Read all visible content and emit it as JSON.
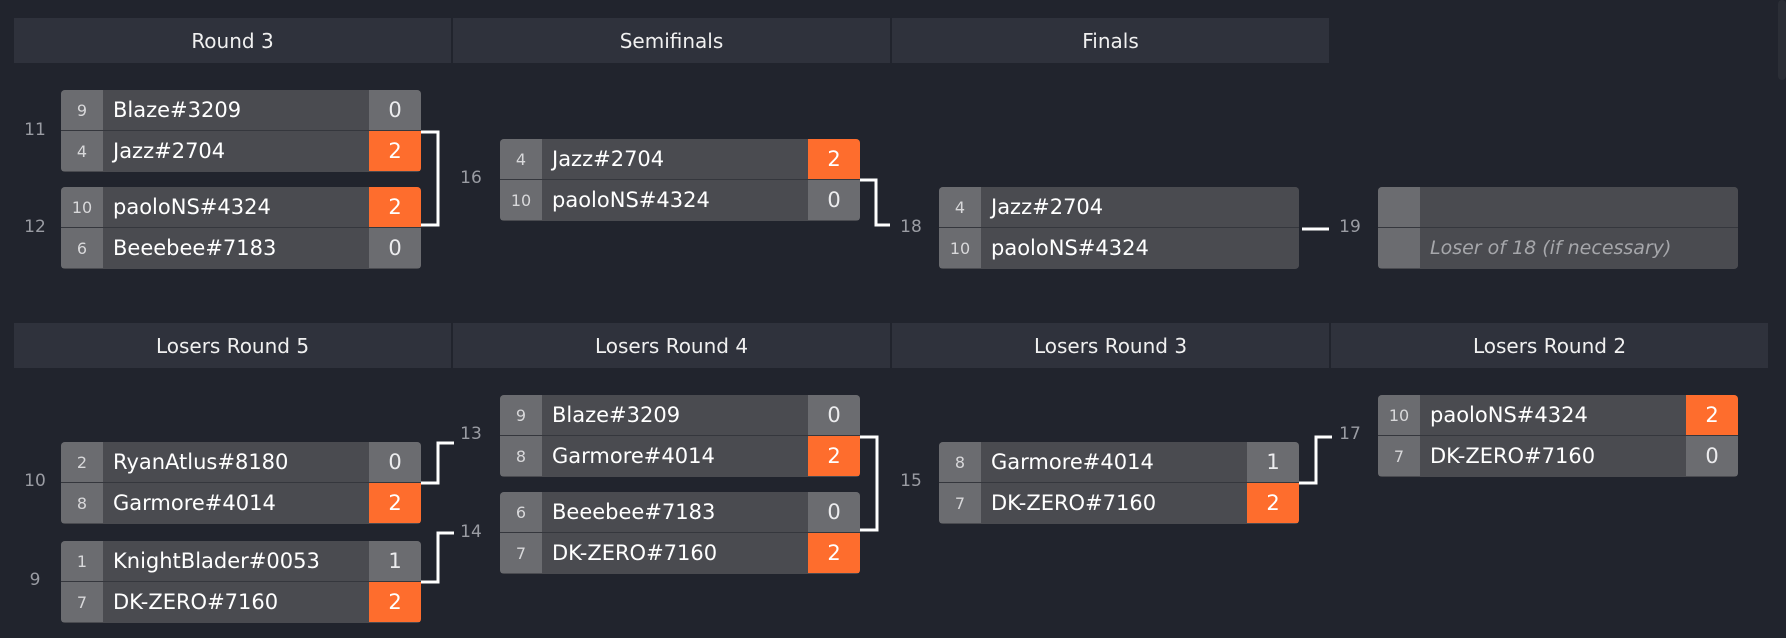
{
  "headers": {
    "round3": "Round 3",
    "semifinals": "Semifinals",
    "finals": "Finals",
    "losers5": "Losers Round 5",
    "losers4": "Losers Round 4",
    "losers3": "Losers Round 3",
    "losers2": "Losers Round 2"
  },
  "match_numbers": {
    "m11": "11",
    "m12": "12",
    "m16": "16",
    "m18": "18",
    "m19": "19",
    "m10": "10",
    "m9": "9",
    "m13": "13",
    "m14": "14",
    "m15": "15",
    "m17": "17"
  },
  "matches": {
    "m11": {
      "top": {
        "seed": "9",
        "name": "Blaze#3209",
        "score": "0"
      },
      "bottom": {
        "seed": "4",
        "name": "Jazz#2704",
        "score": "2"
      }
    },
    "m12": {
      "top": {
        "seed": "10",
        "name": "paoloNS#4324",
        "score": "2"
      },
      "bottom": {
        "seed": "6",
        "name": "Beeebee#7183",
        "score": "0"
      }
    },
    "m16": {
      "top": {
        "seed": "4",
        "name": "Jazz#2704",
        "score": "2"
      },
      "bottom": {
        "seed": "10",
        "name": "paoloNS#4324",
        "score": "0"
      }
    },
    "m18": {
      "top": {
        "seed": "4",
        "name": "Jazz#2704",
        "score": ""
      },
      "bottom": {
        "seed": "10",
        "name": "paoloNS#4324",
        "score": ""
      }
    },
    "m19": {
      "top": {
        "seed": "",
        "name": "",
        "score": ""
      },
      "bottom": {
        "seed": "",
        "name": "Loser of 18 (if necessary)",
        "score": ""
      }
    },
    "m10": {
      "top": {
        "seed": "2",
        "name": "RyanAtlus#8180",
        "score": "0"
      },
      "bottom": {
        "seed": "8",
        "name": "Garmore#4014",
        "score": "2"
      }
    },
    "m9": {
      "top": {
        "seed": "1",
        "name": "KnightBlader#0053",
        "score": "1"
      },
      "bottom": {
        "seed": "7",
        "name": "DK-ZERO#7160",
        "score": "2"
      }
    },
    "m13": {
      "top": {
        "seed": "9",
        "name": "Blaze#3209",
        "score": "0"
      },
      "bottom": {
        "seed": "8",
        "name": "Garmore#4014",
        "score": "2"
      }
    },
    "m14": {
      "top": {
        "seed": "6",
        "name": "Beeebee#7183",
        "score": "0"
      },
      "bottom": {
        "seed": "7",
        "name": "DK-ZERO#7160",
        "score": "2"
      }
    },
    "m15": {
      "top": {
        "seed": "8",
        "name": "Garmore#4014",
        "score": "1"
      },
      "bottom": {
        "seed": "7",
        "name": "DK-ZERO#7160",
        "score": "2"
      }
    },
    "m17": {
      "top": {
        "seed": "10",
        "name": "paoloNS#4324",
        "score": "2"
      },
      "bottom": {
        "seed": "7",
        "name": "DK-ZERO#7160",
        "score": "0"
      }
    }
  },
  "colors": {
    "background": "#21242d",
    "header": "#2f323c",
    "win_score": "#fe6d2d",
    "slot": "#4a4b50",
    "seed": "#6b6c70"
  }
}
